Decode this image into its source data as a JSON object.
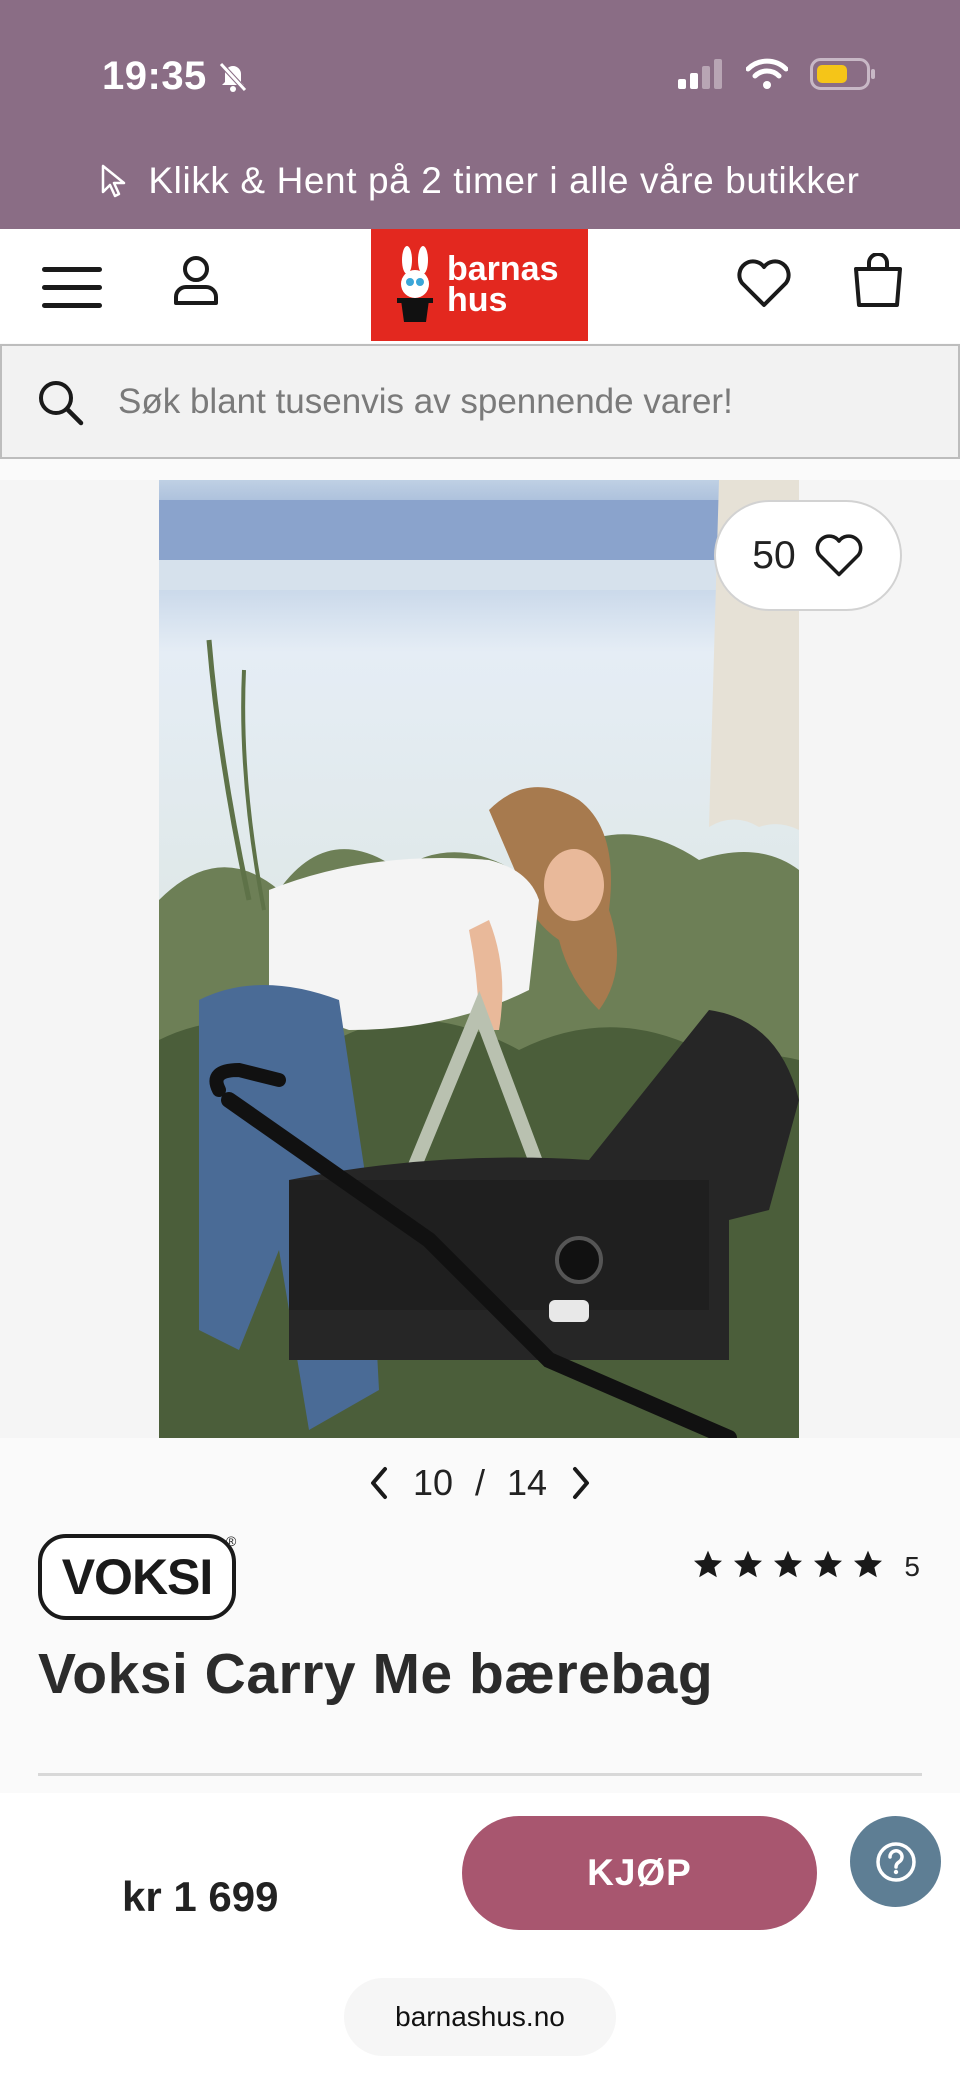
{
  "status_bar": {
    "time": "19:35",
    "icons": [
      "bell-slash-icon",
      "cellular-signal-icon",
      "wifi-icon",
      "battery-icon"
    ],
    "battery_color": "#f5c518"
  },
  "promo_banner": {
    "text": "Klikk & Hent på 2 timer i alle våre butikker",
    "icon": "cursor-icon"
  },
  "header": {
    "logo_text_1": "barnas",
    "logo_text_2": "hus",
    "icons": [
      "menu-icon",
      "user-icon",
      "heart-icon",
      "shopping-bag-icon"
    ]
  },
  "search": {
    "placeholder": "Søk blant tusenvis av spennende varer!"
  },
  "gallery": {
    "like_count": "50",
    "current": "10",
    "separator": "/",
    "total": "14"
  },
  "product": {
    "brand": "VOKSI",
    "brand_mark": "®",
    "rating_stars": 5,
    "rating_count": "5",
    "title": "Voksi Carry Me bærebag",
    "price": "kr 1 699",
    "buy_label": "KJØP"
  },
  "footer": {
    "url": "barnashus.no"
  },
  "colors": {
    "top_bar": "#8a6d85",
    "logo_red": "#e3281f",
    "buy_button": "#a8566f",
    "help_button": "#5e7e94"
  }
}
